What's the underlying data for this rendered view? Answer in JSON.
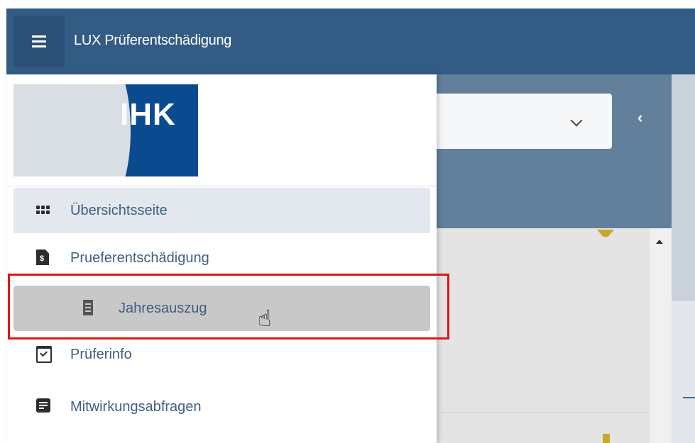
{
  "app": {
    "title": "LUX Prüferentschädigung",
    "menu_icon": "hamburger-icon"
  },
  "logo": {
    "text": "IHK"
  },
  "nav": {
    "items": [
      {
        "label": "Übersichtsseite",
        "icon": "grid-icon",
        "active": true
      },
      {
        "label": "Prueferentschädigung",
        "icon": "invoice-icon"
      },
      {
        "label": "Jahresauszug",
        "icon": "receipt-icon",
        "sub": true,
        "hovered": true
      },
      {
        "label": "Prüferinfo",
        "icon": "calendar-check-icon"
      },
      {
        "label": "Mitwirkungsabfragen",
        "icon": "form-icon"
      }
    ]
  },
  "colors": {
    "topbar": "#335c85",
    "logo_blue": "#0a4b8f",
    "nav_text": "#3f5f80",
    "highlight": "#e01515"
  }
}
